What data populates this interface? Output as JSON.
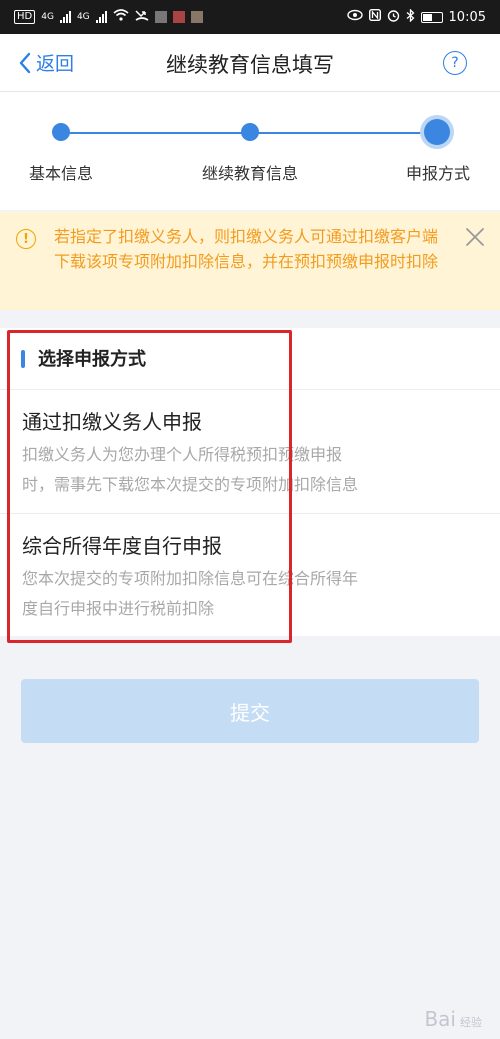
{
  "status_bar": {
    "left_chip": "HD",
    "net1": "4G",
    "net2": "4G",
    "time": "10:05"
  },
  "nav": {
    "back_label": "返回",
    "title": "继续教育信息填写",
    "help_glyph": "?"
  },
  "steps": [
    {
      "label": "基本信息",
      "state": "done"
    },
    {
      "label": "继续教育信息",
      "state": "done"
    },
    {
      "label": "申报方式",
      "state": "active"
    }
  ],
  "notice": {
    "icon_glyph": "!",
    "text": "若指定了扣缴义务人，则扣缴义务人可通过扣缴客户端下载该项专项附加扣除信息，并在预扣预缴申报时扣除"
  },
  "section": {
    "title": "选择申报方式"
  },
  "options": [
    {
      "title": "通过扣缴义务人申报",
      "desc_line1": "扣缴义务人为您办理个人所得税预扣预缴申报",
      "desc_line2": "时，需事先下载您本次提交的专项附加扣除信息"
    },
    {
      "title": "综合所得年度自行申报",
      "desc_line1": "您本次提交的专项附加扣除信息可在综合所得年",
      "desc_line2": "度自行申报中进行税前扣除"
    }
  ],
  "submit_label": "提交",
  "watermark": {
    "text": "Bai",
    "sub": "经验"
  },
  "colors": {
    "accent": "#3a86e0",
    "notice_bg": "#fff4d6",
    "notice_text": "#f29c1f",
    "highlight": "#d8262b",
    "submit_bg": "#c5dcf5"
  }
}
